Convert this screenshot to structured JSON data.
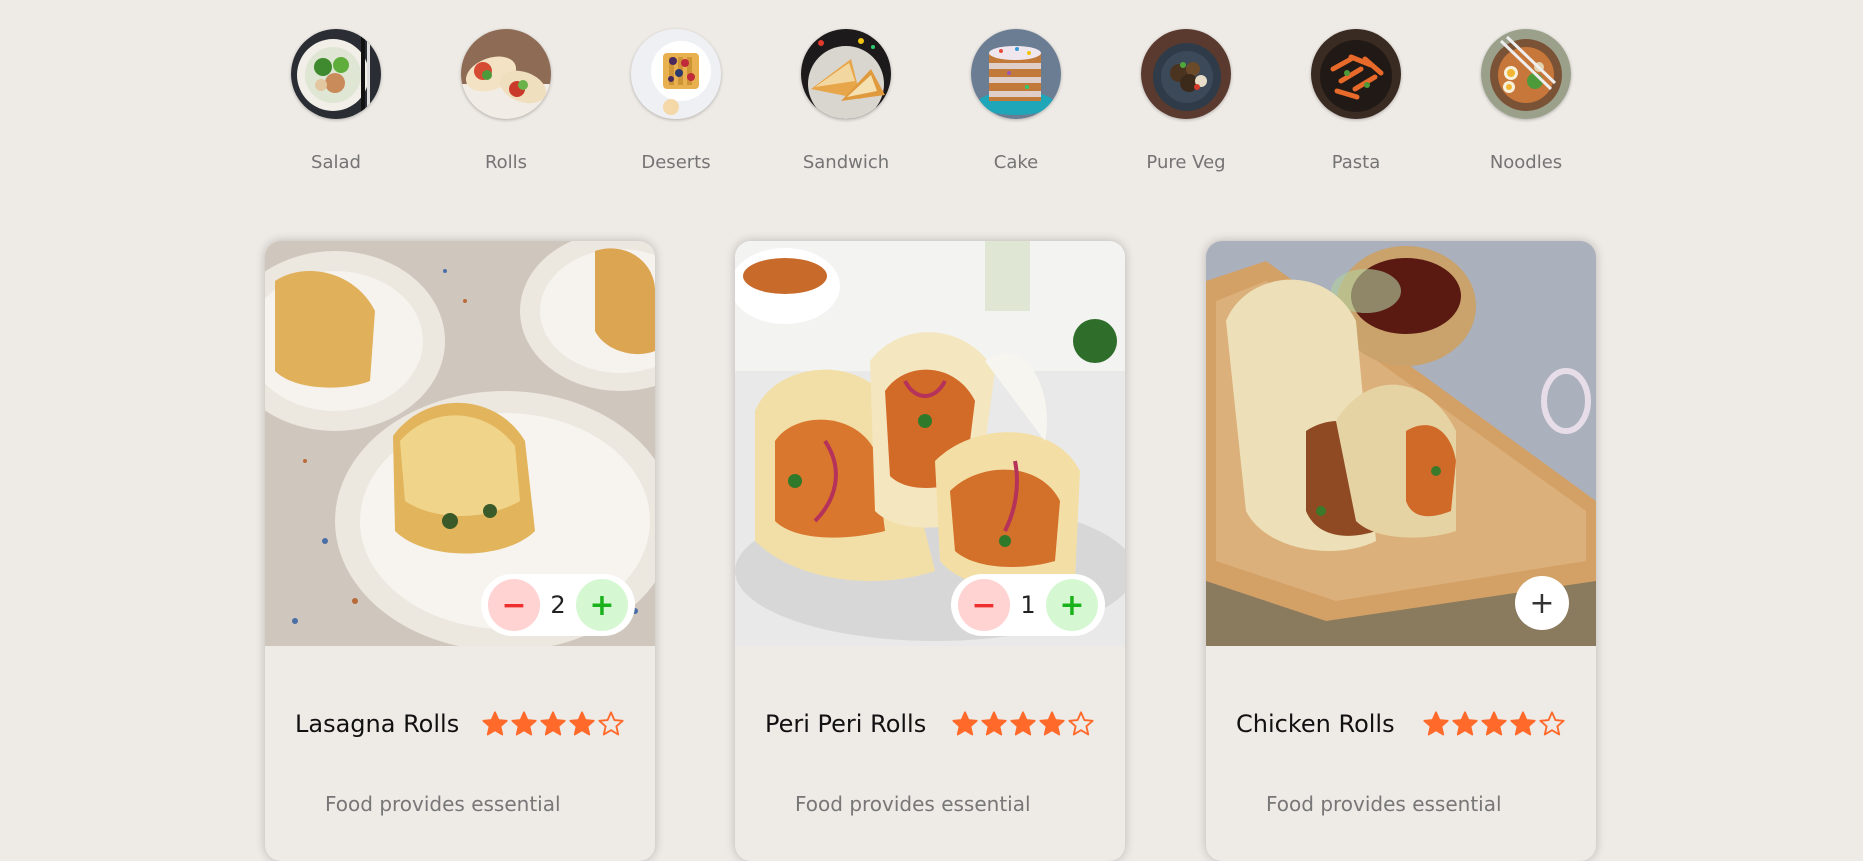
{
  "menu": [
    {
      "label": "Salad",
      "icon": "salad-bowl-icon"
    },
    {
      "label": "Rolls",
      "icon": "rolls-icon"
    },
    {
      "label": "Deserts",
      "icon": "waffle-icon"
    },
    {
      "label": "Sandwich",
      "icon": "sandwich-icon"
    },
    {
      "label": "Cake",
      "icon": "cake-icon"
    },
    {
      "label": "Pure Veg",
      "icon": "veg-plate-icon"
    },
    {
      "label": "Pasta",
      "icon": "pasta-icon"
    },
    {
      "label": "Noodles",
      "icon": "noodles-icon"
    }
  ],
  "cards": [
    {
      "name": "Lasagna Rolls",
      "rating": 4,
      "max_rating": 5,
      "quantity": "2",
      "in_cart": true,
      "desc": "Food provides essential"
    },
    {
      "name": "Peri Peri Rolls",
      "rating": 4,
      "max_rating": 5,
      "quantity": "1",
      "in_cart": true,
      "desc": "Food provides essential"
    },
    {
      "name": "Chicken Rolls",
      "rating": 4,
      "max_rating": 5,
      "quantity": "",
      "in_cart": false,
      "desc": "Food provides essential"
    }
  ],
  "counter": {
    "minus": "−",
    "plus": "+",
    "add": "+"
  },
  "colors": {
    "background": "#eeeae6",
    "star": "#ff6a2b",
    "minus": "#ef2e2e",
    "plus": "#1ab21a"
  }
}
